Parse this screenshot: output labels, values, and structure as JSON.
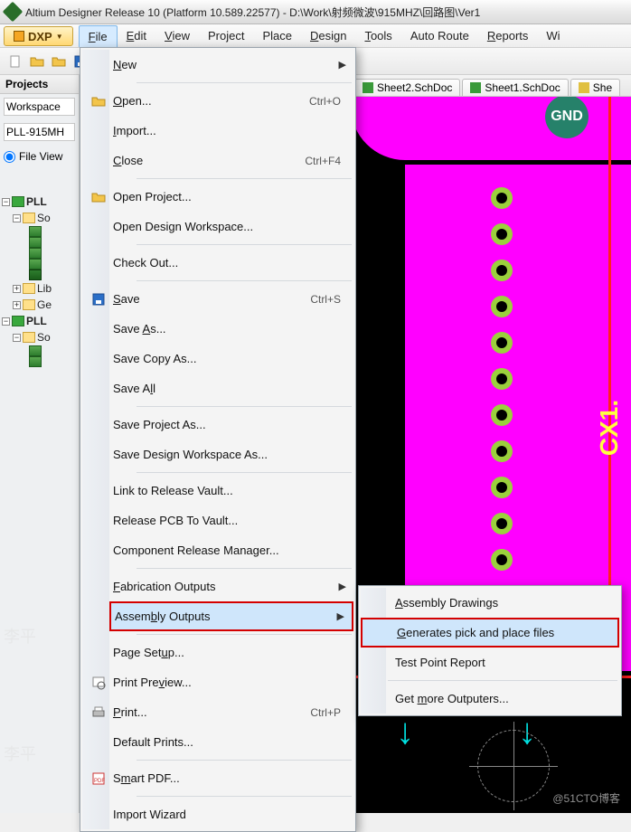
{
  "title": "Altium Designer Release 10 (Platform 10.589.22577) - D:\\Work\\射频微波\\915MHZ\\回路图\\Ver1",
  "dxp_label": "DXP",
  "menubar": [
    "File",
    "Edit",
    "View",
    "Project",
    "Place",
    "Design",
    "Tools",
    "Auto Route",
    "Reports",
    "Wi"
  ],
  "menubar_mnemo": [
    "F",
    "E",
    "V",
    "P",
    "P",
    "D",
    "T",
    "A",
    "R",
    "W"
  ],
  "panel_title": "Projects",
  "ws_value": "Workspace",
  "prj_value": "PLL-915MH",
  "fileview_label": "File View",
  "tree": {
    "p1": "PLL",
    "p1_src": "So",
    "p2": "PLL",
    "p2_src": "So",
    "lib": "Lib",
    "ge": "Ge"
  },
  "tabs": {
    "t2": "Sheet2.SchDoc",
    "t1": "Sheet1.SchDoc",
    "t3": "She"
  },
  "gnd_label": "GND",
  "cx_label": "CX1.",
  "menu": {
    "new": "New",
    "open": "Open...",
    "open_k": "Ctrl+O",
    "import": "Import...",
    "close": "Close",
    "close_k": "Ctrl+F4",
    "open_project": "Open Project...",
    "open_dw": "Open Design Workspace...",
    "checkout": "Check Out...",
    "save": "Save",
    "save_k": "Ctrl+S",
    "save_as": "Save As...",
    "save_copy": "Save Copy As...",
    "save_all": "Save All",
    "save_prj_as": "Save Project As...",
    "save_dw_as": "Save Design Workspace As...",
    "link_vault": "Link to Release Vault...",
    "rel_pcb": "Release PCB To Vault...",
    "comp_rel": "Component Release Manager...",
    "fab_out": "Fabrication Outputs",
    "asm_out": "Assembly Outputs",
    "page_setup": "Page Setup...",
    "print_prev": "Print Preview...",
    "print": "Print...",
    "print_k": "Ctrl+P",
    "def_prints": "Default Prints...",
    "smart_pdf": "Smart PDF...",
    "import_wiz": "Import Wizard"
  },
  "submenu": {
    "asm_draw": "Assembly Drawings",
    "gen_pnp": "Generates pick and place files",
    "test_pt": "Test Point Report",
    "get_more": "Get more Outputers..."
  },
  "watermark": "@51CTO博客",
  "ghost1": "李平",
  "ghost2": "李平"
}
